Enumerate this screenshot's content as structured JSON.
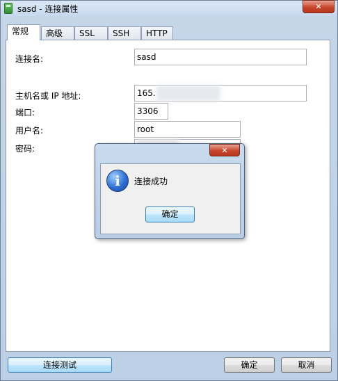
{
  "window": {
    "title": "sasd - 连接属性",
    "close_glyph": "✕"
  },
  "tabs": [
    {
      "label": "常规",
      "active": true
    },
    {
      "label": "高级",
      "active": false
    },
    {
      "label": "SSL",
      "active": false
    },
    {
      "label": "SSH",
      "active": false
    },
    {
      "label": "HTTP",
      "active": false
    }
  ],
  "form": {
    "connection_name_label": "连接名:",
    "connection_name_value": "sasd",
    "host_label": "主机名或 IP 地址:",
    "host_value": "165.",
    "port_label": "端口:",
    "port_value": "3306",
    "username_label": "用户名:",
    "username_value": "root",
    "password_label": "密码:"
  },
  "footer": {
    "test_button": "连接测试",
    "ok_button": "确定",
    "cancel_button": "取消"
  },
  "dialog": {
    "message": "连接成功",
    "ok_button": "确定",
    "icon": "info-icon",
    "close_glyph": "✕"
  }
}
